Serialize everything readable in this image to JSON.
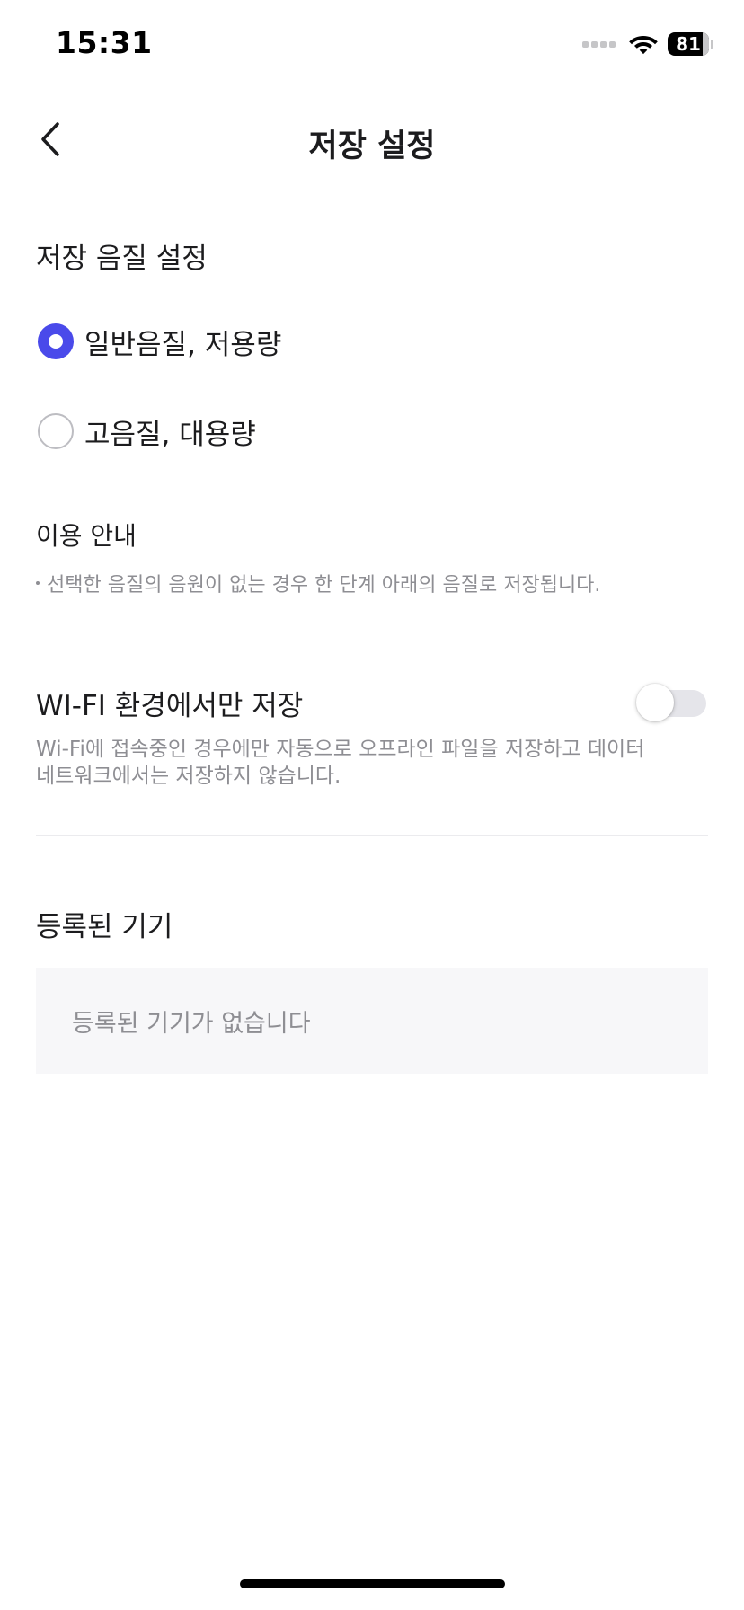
{
  "status_bar": {
    "time": "15:31",
    "battery": "81",
    "icons": [
      "signal-icon",
      "wifi-icon",
      "battery-icon"
    ]
  },
  "nav": {
    "title": "저장 설정",
    "back_icon": "chevron-left-icon"
  },
  "quality": {
    "title": "저장 음질 설정",
    "options": [
      {
        "label": "일반음질, 저용량",
        "selected": true
      },
      {
        "label": "고음질, 대용량",
        "selected": false
      }
    ],
    "accent_color": "#4a4aea"
  },
  "notice": {
    "title": "이용 안내",
    "text": "선택한 음질의 음원이 없는 경우 한 단계 아래의 음질로 저장됩니다."
  },
  "wifi_only": {
    "title": "WI-FI 환경에서만 저장",
    "enabled": false,
    "description_line1": "Wi-Fi에 접속중인 경우에만 자동으로 오프라인 파일을 저장하고 데이터",
    "description_line2": "네트워크에서는 저장하지 않습니다."
  },
  "devices": {
    "title": "등록된 기기",
    "empty_text": "등록된 기기가 없습니다"
  }
}
